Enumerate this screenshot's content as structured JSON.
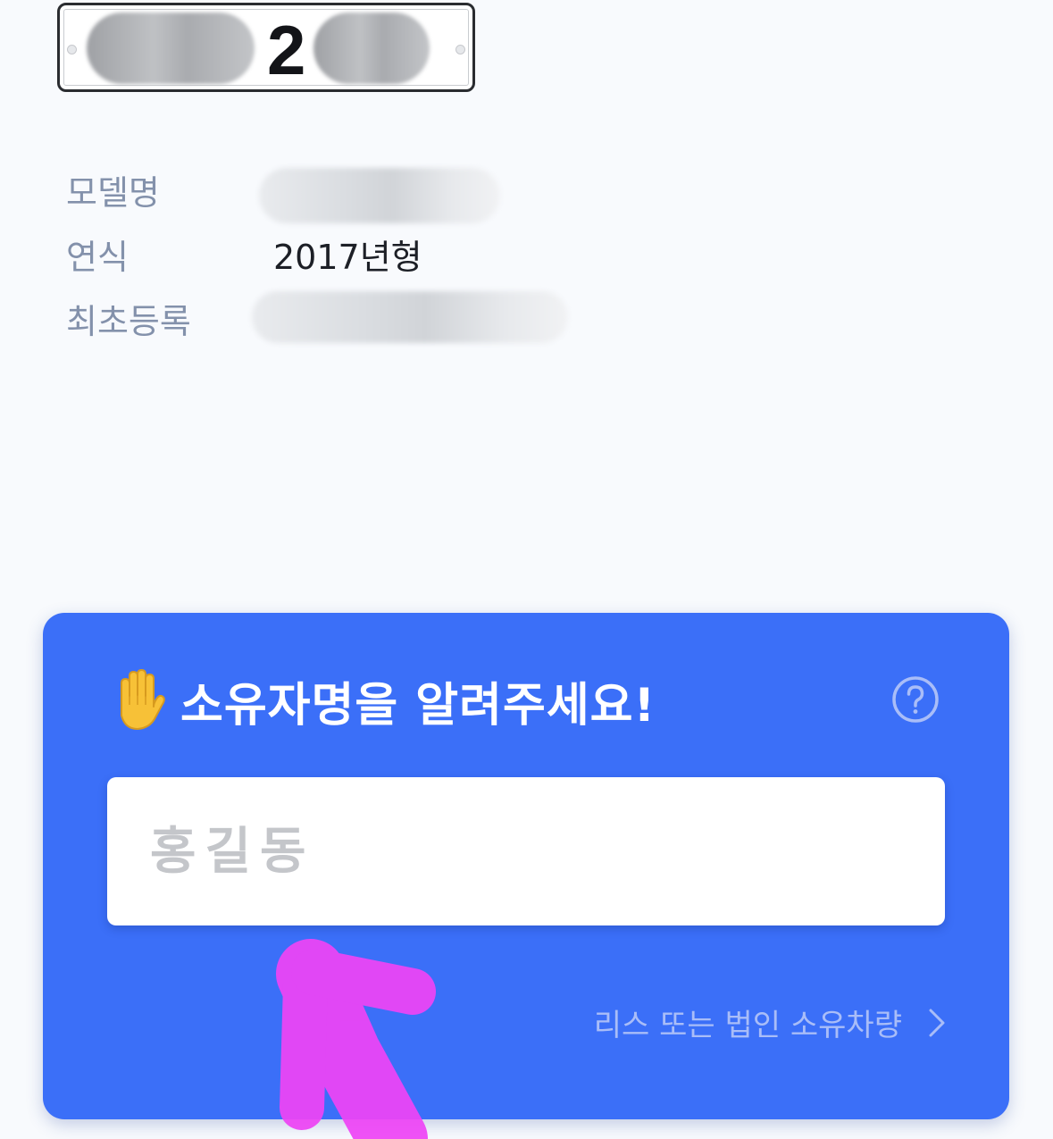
{
  "plate": {
    "visible_text": "2"
  },
  "vehicle_info": {
    "model_label": "모델명",
    "year_label": "연식",
    "year_value": "2017년형",
    "registration_label": "최초등록"
  },
  "owner_card": {
    "title": "소유자명을 알려주세요!",
    "name_placeholder": "홍길동",
    "name_value": "",
    "lease_link": "리스 또는 법인 소유차량",
    "accent_color": "#3b6ff8"
  },
  "annotation": {
    "arrow_color": "#ee44f5"
  }
}
